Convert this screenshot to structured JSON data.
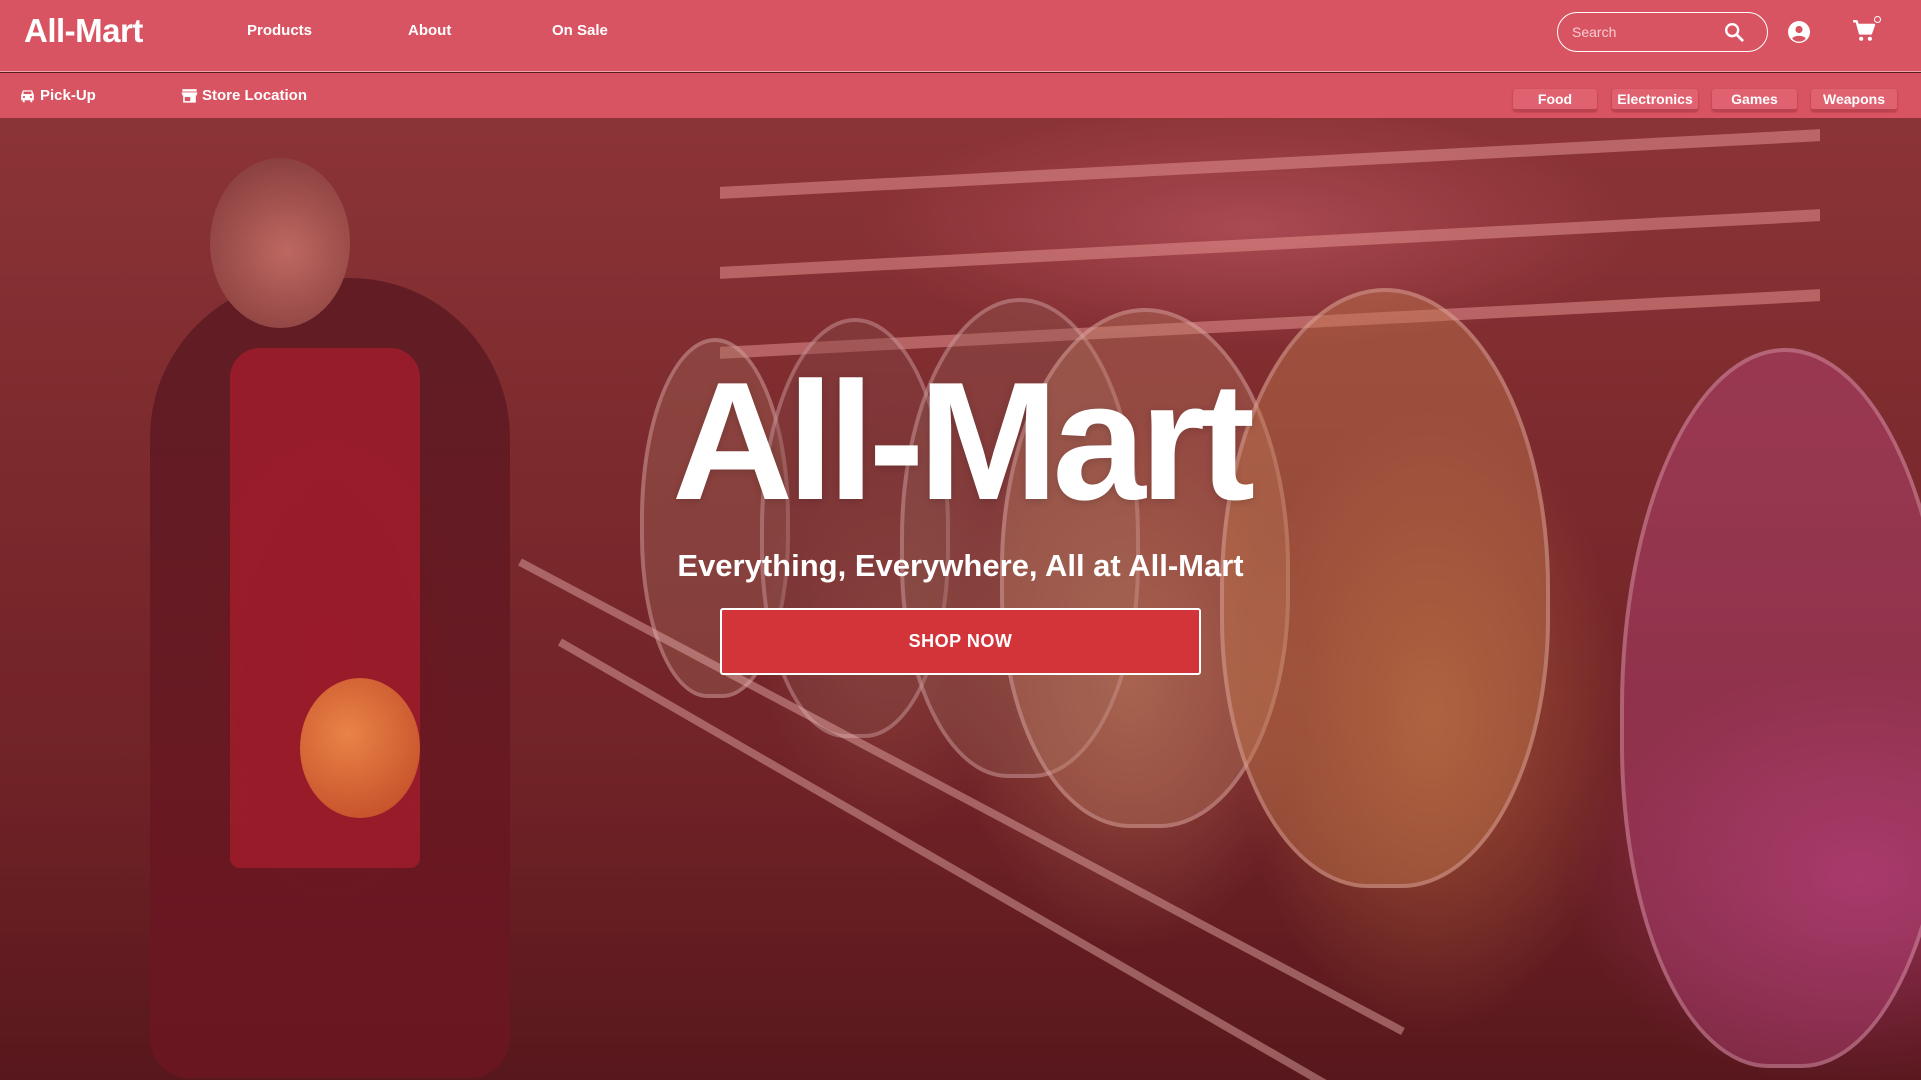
{
  "header": {
    "brand": "All-Mart",
    "nav": [
      "Products",
      "About",
      "On Sale"
    ],
    "search": {
      "placeholder": "Search",
      "value": ""
    }
  },
  "subheader": {
    "links": [
      {
        "label": "Pick-Up",
        "icon": "car-icon"
      },
      {
        "label": "Store Location",
        "icon": "store-icon"
      }
    ],
    "categories": [
      "Food",
      "Electronics",
      "Games",
      "Weapons"
    ]
  },
  "hero": {
    "title": "All-Mart",
    "subtitle": "Everything, Everywhere, All at All-Mart",
    "cta": "SHOP NOW",
    "image": "store-bulk-candy-jars-photo"
  },
  "icons": {
    "search": "search-icon",
    "account": "account-circle-icon",
    "cart": "shopping-cart-icon"
  },
  "colors": {
    "header_bg": "#d95462",
    "cta_bg": "#d3343a",
    "text": "#ffffff"
  }
}
